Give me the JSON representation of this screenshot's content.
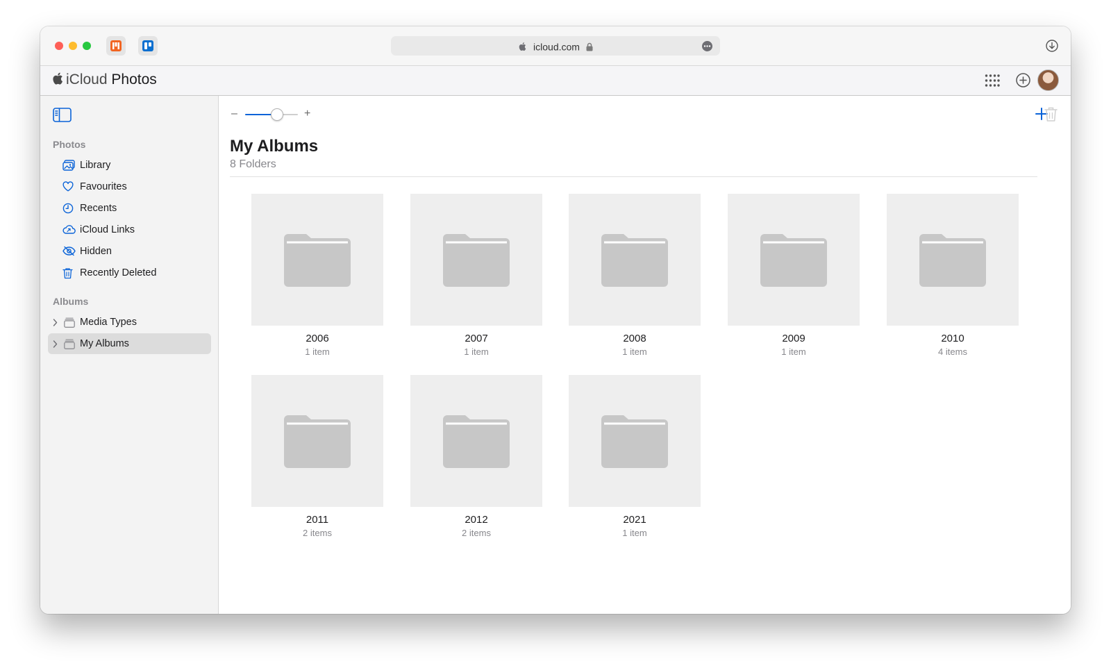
{
  "browser": {
    "url": "icloud.com",
    "icons": [
      "lock-icon",
      "more-options-icon",
      "download-icon"
    ]
  },
  "header": {
    "brand_icloud": "iCloud",
    "brand_photos": "Photos"
  },
  "sidebar": {
    "photos_section": "Photos",
    "photos_items": [
      {
        "label": "Library",
        "icon": "library-icon"
      },
      {
        "label": "Favourites",
        "icon": "heart-icon"
      },
      {
        "label": "Recents",
        "icon": "clock-icon"
      },
      {
        "label": "iCloud Links",
        "icon": "cloud-link-icon"
      },
      {
        "label": "Hidden",
        "icon": "hidden-eye-icon"
      },
      {
        "label": "Recently Deleted",
        "icon": "trash-icon"
      }
    ],
    "albums_section": "Albums",
    "album_items": [
      {
        "label": "Media Types",
        "selected": false
      },
      {
        "label": "My Albums",
        "selected": true
      }
    ]
  },
  "main": {
    "title": "My Albums",
    "subtitle": "8 Folders",
    "zoom_minus": "–",
    "zoom_plus": "+",
    "zoom_level": 0.6,
    "folders": [
      {
        "name": "2006",
        "count": "1 item"
      },
      {
        "name": "2007",
        "count": "1 item"
      },
      {
        "name": "2008",
        "count": "1 item"
      },
      {
        "name": "2009",
        "count": "1 item"
      },
      {
        "name": "2010",
        "count": "4 items"
      },
      {
        "name": "2011",
        "count": "2 items"
      },
      {
        "name": "2012",
        "count": "2 items"
      },
      {
        "name": "2021",
        "count": "1 item"
      }
    ]
  },
  "colors": {
    "accent": "#0a63d8",
    "sidebar_bg": "#f3f3f3",
    "tile_bg": "#eeeeee",
    "folder_glyph": "#c7c7c7"
  }
}
